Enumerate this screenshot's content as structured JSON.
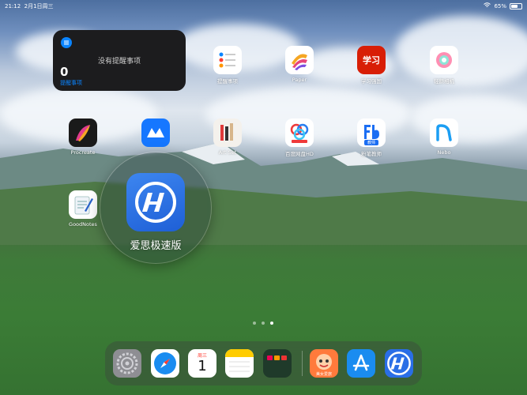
{
  "status": {
    "time": "21:12",
    "date": "2月1日周三",
    "battery": "65%"
  },
  "widget": {
    "empty_text": "没有提醒事项",
    "count": "0",
    "label": "提醒事项"
  },
  "apps": {
    "reminders": "提醒事项",
    "paper": "Paper",
    "xuexi": "学习强国",
    "camera": "轻颜相机",
    "procreate": "Procreate",
    "artset": "Art Set",
    "baidu": "百度网盘HD",
    "fenbi": "粉笔教师",
    "nebo": "Nebo",
    "goodnotes": "GoodNotes"
  },
  "featured": {
    "label": "爱思极速版"
  },
  "icon_text": {
    "xuexi_glyph": "学习",
    "calendar_day": "周三",
    "calendar_date": "1",
    "fenbi_sub": "教师",
    "game_label": "美女爱旅"
  },
  "colors": {
    "accent": "#0a84ff",
    "ai_blue": "#2a6ee6"
  }
}
